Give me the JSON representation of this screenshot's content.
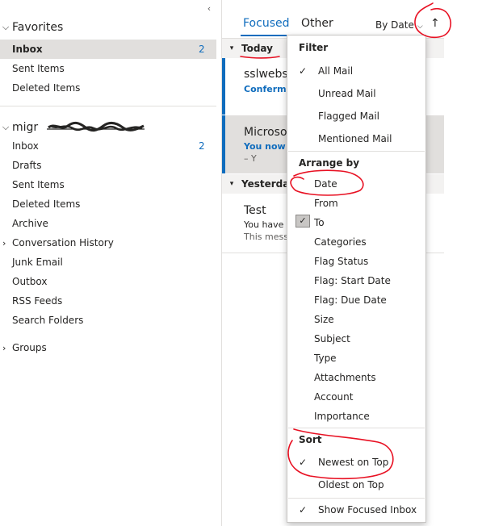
{
  "folder_pane": {
    "collapse_glyph": "‹",
    "favorites": {
      "title": "Favorites",
      "items": [
        {
          "label": "Inbox",
          "count": "2"
        },
        {
          "label": "Sent Items",
          "count": ""
        },
        {
          "label": "Deleted Items",
          "count": ""
        }
      ]
    },
    "account": {
      "title": "migr",
      "items": [
        {
          "label": "Inbox",
          "count": "2"
        },
        {
          "label": "Drafts",
          "count": ""
        },
        {
          "label": "Sent Items",
          "count": ""
        },
        {
          "label": "Deleted Items",
          "count": ""
        },
        {
          "label": "Archive",
          "count": ""
        },
        {
          "label": "Conversation History",
          "count": ""
        },
        {
          "label": "Junk Email",
          "count": ""
        },
        {
          "label": "Outbox",
          "count": ""
        },
        {
          "label": "RSS Feeds",
          "count": ""
        },
        {
          "label": "Search Folders",
          "count": ""
        }
      ]
    },
    "groups": {
      "title": "Groups"
    }
  },
  "message_list": {
    "tabs": {
      "focused": "Focused",
      "other": "Other"
    },
    "sort_label": "By Date",
    "sort_direction_glyph": "↑",
    "sections": {
      "today": "Today",
      "yesterday": "Yesterday"
    },
    "messages": [
      {
        "sender": "sslwebs",
        "subject": "Conferma",
        "preview": ""
      },
      {
        "sender": "Microso",
        "subject": "You now f",
        "preview": "–        Y"
      },
      {
        "sender": "Test",
        "subject": "You have b",
        "preview": "This messa"
      }
    ]
  },
  "sort_menu": {
    "filter": {
      "heading": "Filter",
      "items": [
        {
          "label": "All Mail",
          "checked": true
        },
        {
          "label": "Unread Mail",
          "checked": false
        },
        {
          "label": "Flagged Mail",
          "checked": false
        },
        {
          "label": "Mentioned Mail",
          "checked": false
        }
      ]
    },
    "arrange": {
      "heading": "Arrange by",
      "items": [
        "Date",
        "From",
        "To",
        "Categories",
        "Flag Status",
        "Flag: Start Date",
        "Flag: Due Date",
        "Size",
        "Subject",
        "Type",
        "Attachments",
        "Account",
        "Importance"
      ],
      "selected": "Date"
    },
    "sort": {
      "heading": "Sort",
      "items": [
        {
          "label": "Newest on Top",
          "checked": true
        },
        {
          "label": "Oldest on Top",
          "checked": false
        }
      ]
    },
    "show_focused": {
      "label": "Show Focused Inbox",
      "checked": true
    }
  },
  "colors": {
    "accent": "#0f6cbd",
    "selection": "#e1dfdd",
    "annotation": "#e81123"
  }
}
